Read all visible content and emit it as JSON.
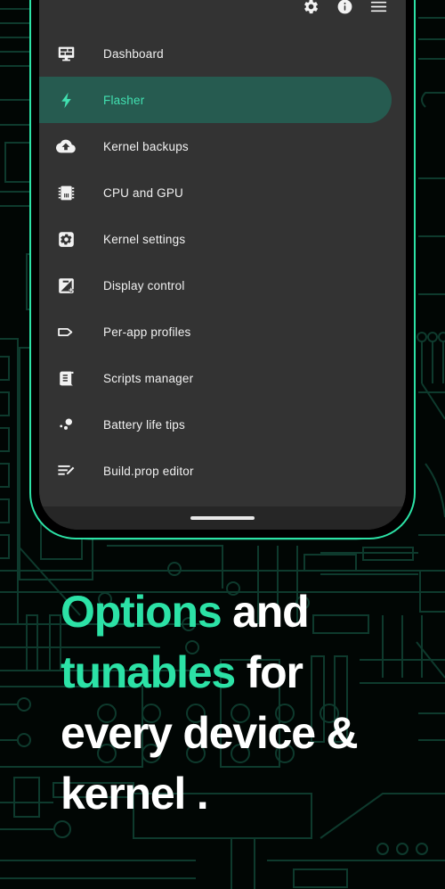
{
  "app": {
    "screen_background": "#333333",
    "accent": "#2ce2a6",
    "selected_item_background": "#265b50",
    "selected_item_text": "#41e0b0"
  },
  "appbar": {
    "actions": [
      {
        "name": "settings",
        "icon": "gear-icon",
        "label": "Settings"
      },
      {
        "name": "info",
        "icon": "info-icon",
        "label": "About"
      },
      {
        "name": "menu",
        "icon": "hamburger-menu-icon",
        "label": "Menu"
      }
    ]
  },
  "drawer": {
    "items": [
      {
        "label": "Dashboard",
        "icon": "dashboard-monitor-icon",
        "selected": false
      },
      {
        "label": "Flasher",
        "icon": "lightning-bolt-icon",
        "selected": true
      },
      {
        "label": "Kernel backups",
        "icon": "cloud-upload-icon",
        "selected": false
      },
      {
        "label": "CPU and GPU",
        "icon": "cpu-chip-icon",
        "selected": false
      },
      {
        "label": "Kernel settings",
        "icon": "gear-square-icon",
        "selected": false
      },
      {
        "label": "Display control",
        "icon": "brightness-contrast-icon",
        "selected": false
      },
      {
        "label": "Per-app profiles",
        "icon": "tag-icon",
        "selected": false
      },
      {
        "label": "Scripts manager",
        "icon": "script-scroll-icon",
        "selected": false
      },
      {
        "label": "Battery life tips",
        "icon": "bubbles-icon",
        "selected": false
      },
      {
        "label": "Build.prop editor",
        "icon": "list-edit-icon",
        "selected": false
      }
    ]
  },
  "gesture_bar": {
    "home_indicator": "home-indicator"
  },
  "headline": {
    "line1_accent": "Options",
    "line1_rest": " and",
    "line2_accent": "tunables",
    "line2_rest": " for",
    "line3": "every device &",
    "line4": "kernel ."
  }
}
